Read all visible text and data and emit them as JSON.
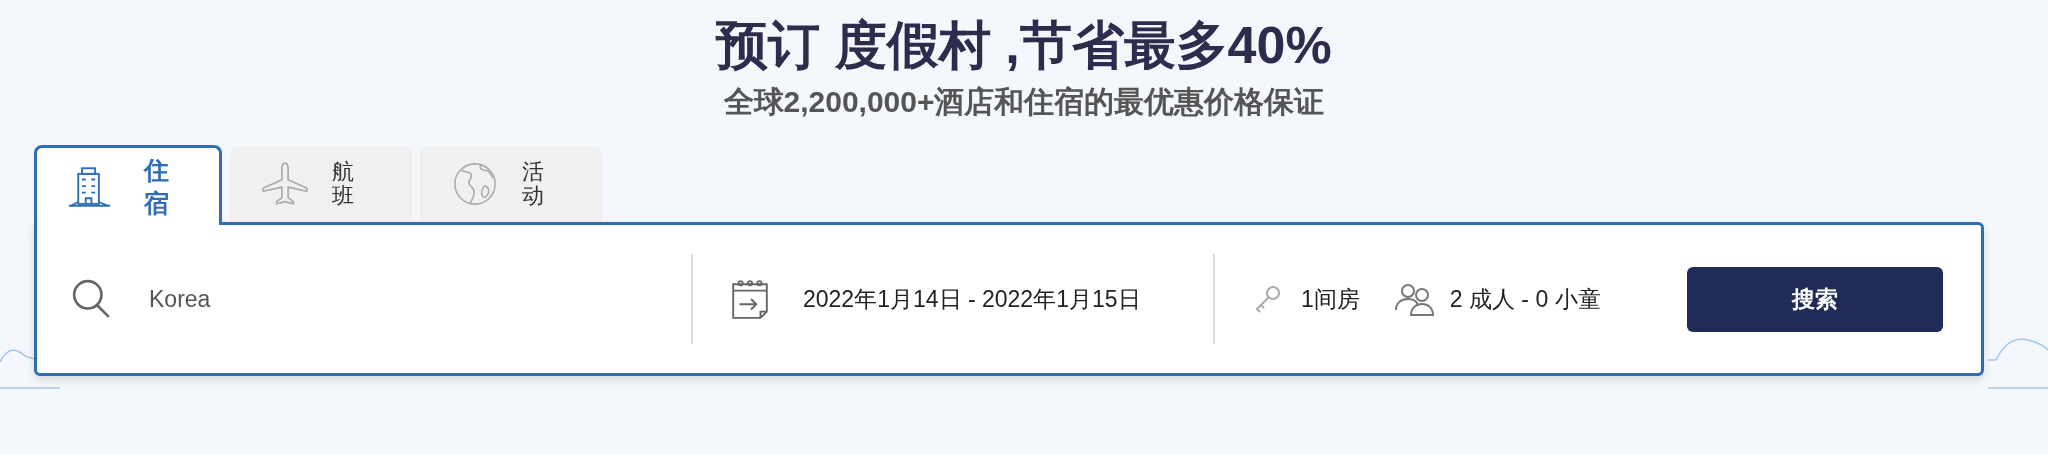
{
  "headline": "预订 度假村 ,节省最多40%",
  "subtitle": "全球2,200,000+酒店和住宿的最优惠价格保证",
  "tabs": [
    {
      "label": "住宿",
      "kind": "hotel",
      "selected": true
    },
    {
      "label": "航班",
      "kind": "flight",
      "selected": false
    },
    {
      "label": "活动",
      "kind": "activity",
      "selected": false
    }
  ],
  "search": {
    "value": "Korea"
  },
  "dates": "2022年1月14日 - 2022年1月15日",
  "rooms": "1间房",
  "guests": "2 成人 - 0 小童",
  "search_button": "搜索"
}
